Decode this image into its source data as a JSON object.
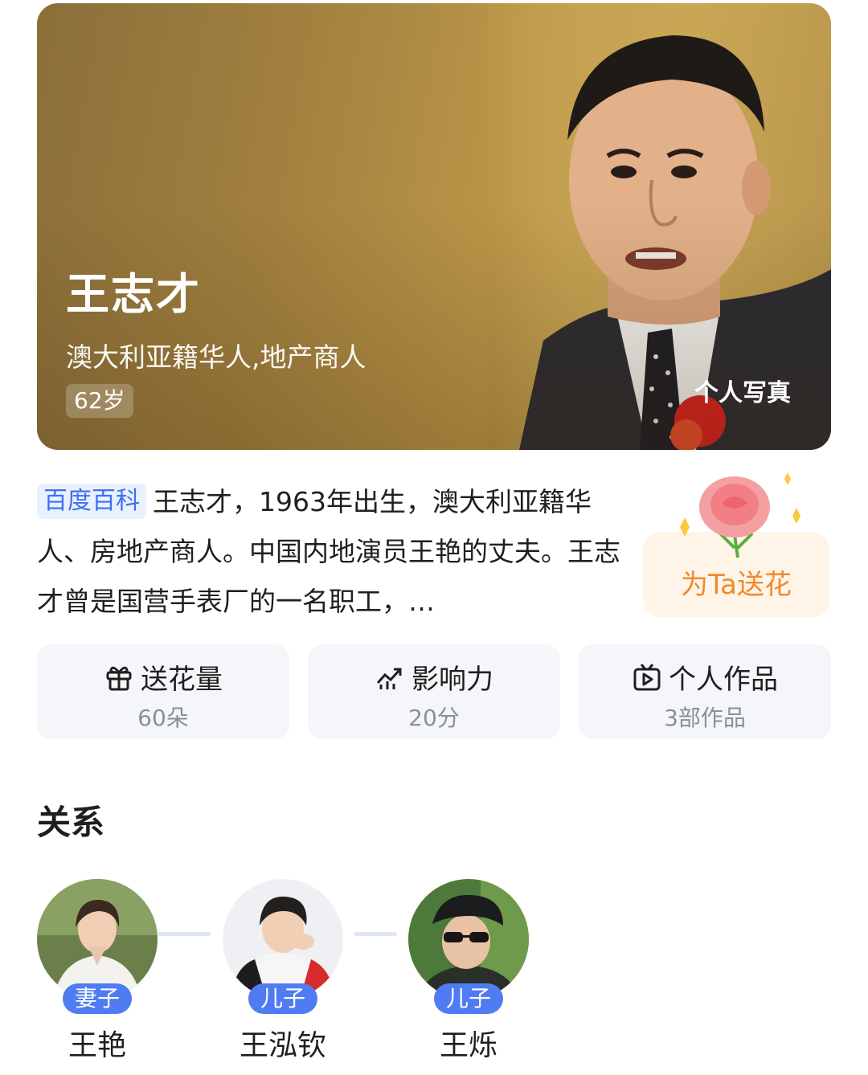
{
  "hero": {
    "name": "王志才",
    "description": "澳大利亚籍华人,地产商人",
    "age": "62岁",
    "photo_button": "个人写真"
  },
  "summary": {
    "source_tag": "百度百科",
    "text": "王志才，1963年出生，澳大利亚籍华人、房地产商人。中国内地演员王艳的丈夫。王志才曾是国营手表厂的一名职工，…"
  },
  "flower_button": {
    "label": "为Ta送花"
  },
  "stats": [
    {
      "icon": "gift-icon",
      "title": "送花量",
      "value": "60朵"
    },
    {
      "icon": "trend-icon",
      "title": "影响力",
      "value": "20分"
    },
    {
      "icon": "video-icon",
      "title": "个人作品",
      "value": "3部作品"
    }
  ],
  "relations": {
    "title": "关系",
    "items": [
      {
        "relation": "妻子",
        "name": "王艳"
      },
      {
        "relation": "儿子",
        "name": "王泓钦"
      },
      {
        "relation": "儿子",
        "name": "王烁"
      }
    ]
  },
  "colors": {
    "accent_blue": "#4f7cf3",
    "tag_blue": "#3d6ff0",
    "flower_orange": "#f08a2c",
    "hero_gold": "#b99447"
  }
}
